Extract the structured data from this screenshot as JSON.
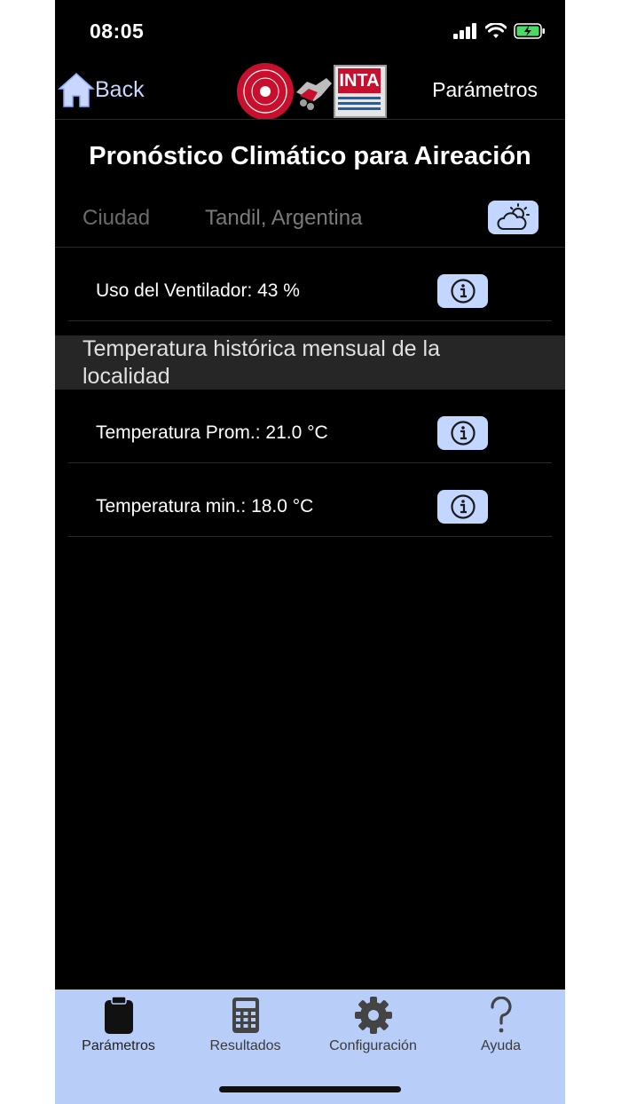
{
  "status": {
    "time": "08:05"
  },
  "nav": {
    "back_label": "Back",
    "right_label": "Parámetros",
    "logo_text": "INTA"
  },
  "title": "Pronóstico Climático para Aireación",
  "city": {
    "label": "Ciudad",
    "value": "Tandil, Argentina"
  },
  "fan_usage": {
    "label": "Uso del Ventilador: 43 %"
  },
  "section": {
    "title": "Temperatura histórica mensual de la localidad"
  },
  "temps": [
    {
      "label": "Temperatura Prom.: 21.0 °C"
    },
    {
      "label": "Temperatura min.: 18.0 °C"
    }
  ],
  "tabs": [
    {
      "label": "Parámetros",
      "icon": "clipboard-icon"
    },
    {
      "label": "Resultados",
      "icon": "calculator-icon"
    },
    {
      "label": "Configuración",
      "icon": "gear-icon"
    },
    {
      "label": "Ayuda",
      "icon": "question-icon"
    }
  ],
  "colors": {
    "accent": "#c2d6ff",
    "tabbar_bg": "#b9cdf9",
    "background": "#000000",
    "logo_red": "#c8102e"
  }
}
